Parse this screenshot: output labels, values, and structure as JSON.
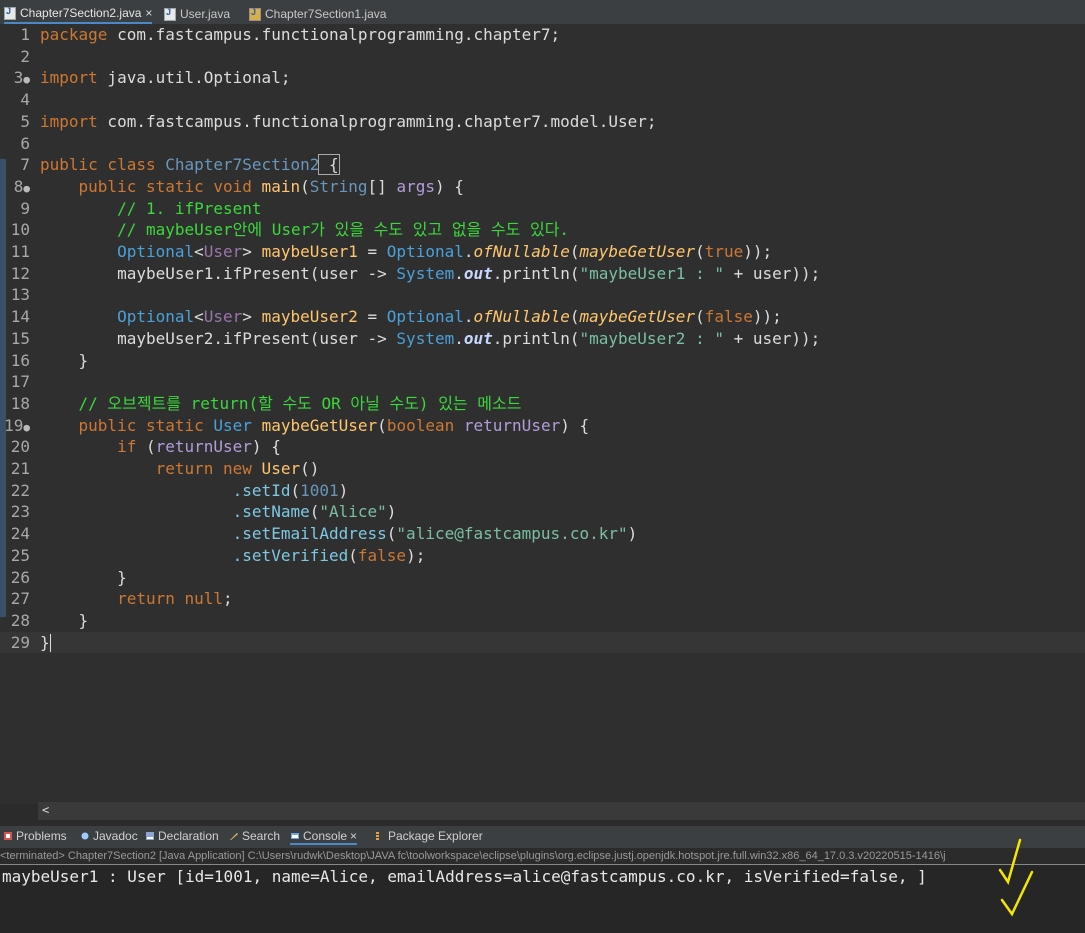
{
  "editor_tabs": [
    {
      "label": "Chapter7Section2.java",
      "close": "×",
      "icon": "java-file-icon"
    },
    {
      "label": "User.java",
      "icon": "java-file-icon"
    },
    {
      "label": "Chapter7Section1.java",
      "icon": "java-class-icon"
    }
  ],
  "line_numbers": [
    "1",
    "2",
    "3",
    "4",
    "5",
    "6",
    "7",
    "8",
    "9",
    "10",
    "11",
    "12",
    "13",
    "14",
    "15",
    "16",
    "17",
    "18",
    "19",
    "20",
    "21",
    "22",
    "23",
    "24",
    "25",
    "26",
    "27",
    "28",
    "29"
  ],
  "code": {
    "l1_a": "package",
    "l1_b": " com.fastcampus.functionalprogramming.chapter7;",
    "l3_a": "import",
    "l3_b": " java.util.Optional;",
    "l5_a": "import",
    "l5_b": " com.fastcampus.functionalprogramming.chapter7.model.User;",
    "l7_a": "public class",
    "l7_b": " Chapter7Section2",
    "l7_c": " {",
    "l8_a": "    public static void",
    "l8_b": " main",
    "l8_c": "(",
    "l8_d": "String",
    "l8_e": "[] ",
    "l8_f": "args",
    "l8_g": ") {",
    "l9": "        // 1. ifPresent",
    "l10": "        // maybeUser안에 User가 있을 수도 있고 없을 수도 있다.",
    "l11_a": "        Optional",
    "l11_b": "<",
    "l11_c": "User",
    "l11_d": "> ",
    "l11_e": "maybeUser1",
    "l11_f": " = ",
    "l11_g": "Optional",
    "l11_h": ".",
    "l11_i": "ofNullable",
    "l11_j": "(",
    "l11_k": "maybeGetUser",
    "l11_l": "(",
    "l11_m": "true",
    "l11_n": "));",
    "l12_a": "        maybeUser1.ifPresent(user -> ",
    "l12_b": "System",
    "l12_c": ".",
    "l12_d": "out",
    "l12_e": ".println(",
    "l12_f": "\"maybeUser1 : \"",
    "l12_g": " + user));",
    "l14_a": "        Optional",
    "l14_b": "<",
    "l14_c": "User",
    "l14_d": "> ",
    "l14_e": "maybeUser2",
    "l14_f": " = ",
    "l14_g": "Optional",
    "l14_h": ".",
    "l14_i": "ofNullable",
    "l14_j": "(",
    "l14_k": "maybeGetUser",
    "l14_l": "(",
    "l14_m": "false",
    "l14_n": "));",
    "l15_a": "        maybeUser2.ifPresent(user -> ",
    "l15_b": "System",
    "l15_c": ".",
    "l15_d": "out",
    "l15_e": ".println(",
    "l15_f": "\"maybeUser2 : \"",
    "l15_g": " + user));",
    "l16": "    }",
    "l18": "    // 오브젝트를 return(할 수도 OR 아닐 수도) 있는 메소드",
    "l19_a": "    public static",
    "l19_b": " User",
    "l19_c": " maybeGetUser",
    "l19_d": "(",
    "l19_e": "boolean",
    "l19_f": " returnUser",
    "l19_g": ") {",
    "l20_a": "        if",
    "l20_b": " (",
    "l20_c": "returnUser",
    "l20_d": ") {",
    "l21_a": "            return new",
    "l21_b": " User",
    "l21_c": "()",
    "l22_a": "                    .setId",
    "l22_b": "(",
    "l22_c": "1001",
    "l22_d": ")",
    "l23_a": "                    .setName",
    "l23_b": "(",
    "l23_c": "\"Alice\"",
    "l23_d": ")",
    "l24_a": "                    .setEmailAddress",
    "l24_b": "(",
    "l24_c": "\"alice@fastcampus.co.kr\"",
    "l24_d": ")",
    "l25_a": "                    .setVerified",
    "l25_b": "(",
    "l25_c": "false",
    "l25_d": ");",
    "l26": "        }",
    "l27_a": "        return",
    "l27_b": " null",
    "l27_c": ";",
    "l28": "    }",
    "l29": "}"
  },
  "scroll_left": "<",
  "view_tabs": [
    {
      "label": "Problems",
      "icon": "problems-icon"
    },
    {
      "label": "Javadoc",
      "icon": "javadoc-icon"
    },
    {
      "label": "Declaration",
      "icon": "declaration-icon"
    },
    {
      "label": "Search",
      "icon": "search-icon"
    },
    {
      "label": "Console",
      "close": "×",
      "icon": "console-icon"
    },
    {
      "label": "Package Explorer",
      "icon": "package-explorer-icon"
    }
  ],
  "console": {
    "terminated": "<terminated> Chapter7Section2 [Java Application] C:\\Users\\rudwk\\Desktop\\JAVA fc\\toolworkspace\\eclipse\\plugins\\org.eclipse.justj.openjdk.hotspot.jre.full.win32.x86_64_17.0.3.v20220515-1416\\j",
    "output": "maybeUser1 : User [id=1001, name=Alice, emailAddress=alice@fastcampus.co.kr, isVerified=false, ]"
  },
  "colors": {
    "accent": "#4a88c7",
    "annotation": "#f5e500"
  }
}
